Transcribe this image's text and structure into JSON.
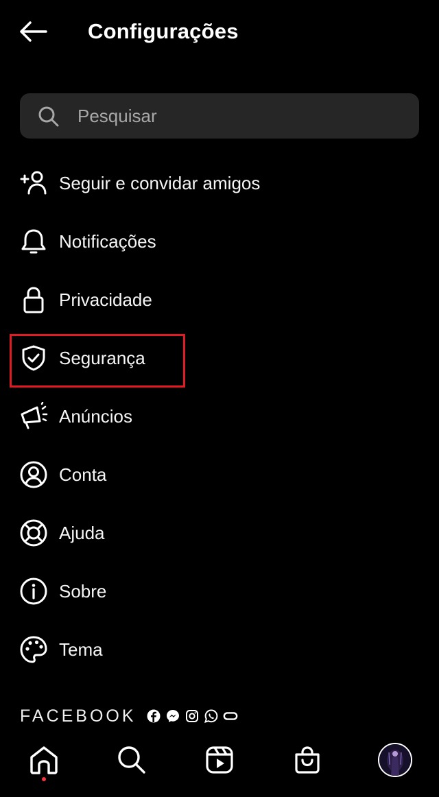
{
  "header": {
    "title": "Configurações",
    "back_icon": "arrow-left-icon"
  },
  "search": {
    "placeholder": "Pesquisar",
    "value": "",
    "icon": "search-icon"
  },
  "menu": {
    "items": [
      {
        "label": "Seguir e convidar amigos",
        "icon": "add-person-icon"
      },
      {
        "label": "Notificações",
        "icon": "bell-icon"
      },
      {
        "label": "Privacidade",
        "icon": "lock-icon"
      },
      {
        "label": "Segurança",
        "icon": "shield-check-icon",
        "highlighted": true
      },
      {
        "label": "Anúncios",
        "icon": "megaphone-icon"
      },
      {
        "label": "Conta",
        "icon": "account-circle-icon"
      },
      {
        "label": "Ajuda",
        "icon": "lifebuoy-icon"
      },
      {
        "label": "Sobre",
        "icon": "info-icon"
      },
      {
        "label": "Tema",
        "icon": "palette-icon"
      }
    ]
  },
  "footer": {
    "brand": "FACEBOOK",
    "app_icons": [
      "facebook-icon",
      "messenger-icon",
      "instagram-icon",
      "whatsapp-icon",
      "portal-icon"
    ]
  },
  "bottom_nav": {
    "items": [
      {
        "name": "home",
        "icon": "home-icon",
        "active": true
      },
      {
        "name": "search",
        "icon": "search-icon"
      },
      {
        "name": "reels",
        "icon": "reels-icon"
      },
      {
        "name": "shop",
        "icon": "shop-bag-icon"
      },
      {
        "name": "profile",
        "icon": "avatar"
      }
    ]
  },
  "colors": {
    "background": "#000000",
    "search_bg": "#262626",
    "highlight": "#e01b24",
    "notification_dot": "#ff3040"
  }
}
